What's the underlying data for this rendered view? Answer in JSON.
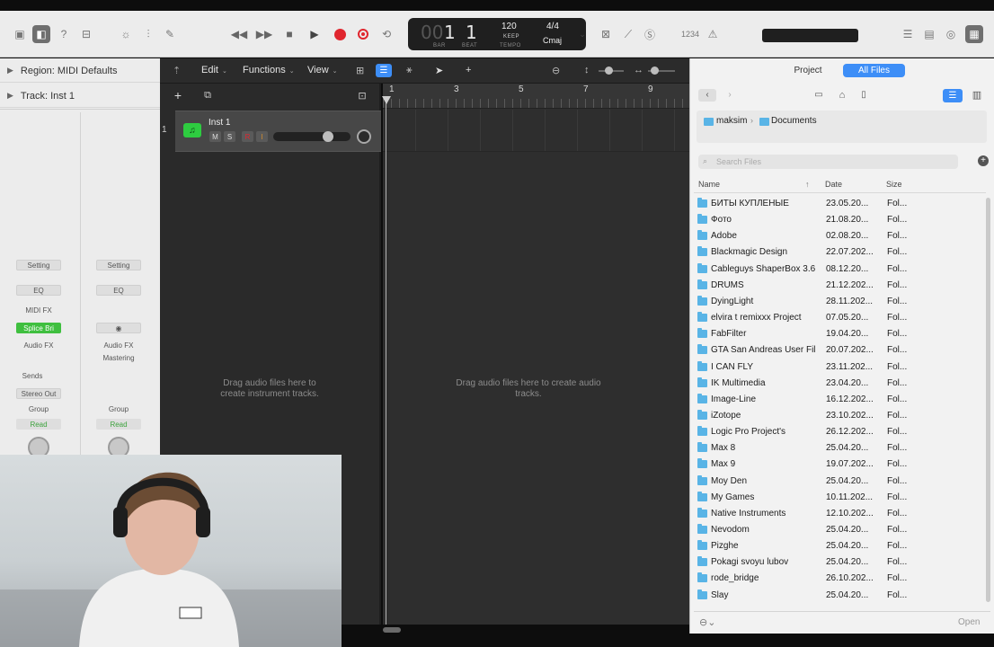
{
  "toolbar": {
    "lcd": {
      "bar_value": "1",
      "beat_value": "1",
      "bar_label": "BAR",
      "beat_label": "BEAT",
      "tempo_value": "120",
      "tempo_mode": "KEEP",
      "tempo_label": "TEMPO",
      "signature": "4/4",
      "key": "Cmaj"
    },
    "count_in": "1234"
  },
  "inspector": {
    "region_label": "Region: MIDI Defaults",
    "track_label": "Track: Inst 1",
    "strip1": {
      "setting": "Setting",
      "eq": "EQ",
      "midi_fx": "MIDI FX",
      "plugin": "Splice Bri",
      "audio_fx": "Audio FX",
      "sends": "Sends",
      "output": "Stereo Out",
      "group": "Group",
      "automation": "Read"
    },
    "strip2": {
      "setting": "Setting",
      "eq": "EQ",
      "audio_fx": "Audio FX",
      "mastering": "Mastering",
      "group": "Group",
      "automation": "Read"
    }
  },
  "tracks": {
    "menus": [
      "Edit",
      "Functions",
      "View"
    ],
    "track_number": "1",
    "track_name": "Inst 1",
    "mute": "M",
    "solo": "S",
    "record": "R",
    "input_monitor": "I",
    "header_hint": "Drag audio files here to create instrument tracks.",
    "arrange_hint": "Drag audio files here to create audio tracks.",
    "ruler": [
      "1",
      "3",
      "5",
      "7",
      "9"
    ]
  },
  "browser": {
    "tabs": [
      "Project",
      "All Files"
    ],
    "active_tab": "All Files",
    "path": [
      "maksim",
      "Documents"
    ],
    "search_placeholder": "Search Files",
    "columns": [
      "Name",
      "Date",
      "Size"
    ],
    "files": [
      {
        "name": "БИТЫ КУПЛЕНЫЕ",
        "date": "23.05.20...",
        "size": "Fol..."
      },
      {
        "name": "Фото",
        "date": "21.08.20...",
        "size": "Fol..."
      },
      {
        "name": "Adobe",
        "date": "02.08.20...",
        "size": "Fol..."
      },
      {
        "name": "Blackmagic Design",
        "date": "22.07.202...",
        "size": "Fol..."
      },
      {
        "name": "Cableguys ShaperBox 3.6",
        "date": "08.12.20...",
        "size": "Fol..."
      },
      {
        "name": "DRUMS",
        "date": "21.12.202...",
        "size": "Fol..."
      },
      {
        "name": "DyingLight",
        "date": "28.11.202...",
        "size": "Fol..."
      },
      {
        "name": "elvira t remixxx Project",
        "date": "07.05.20...",
        "size": "Fol..."
      },
      {
        "name": "FabFilter",
        "date": "19.04.20...",
        "size": "Fol..."
      },
      {
        "name": "GTA San Andreas User Fil",
        "date": "20.07.202...",
        "size": "Fol..."
      },
      {
        "name": "I CAN FLY",
        "date": "23.11.202...",
        "size": "Fol..."
      },
      {
        "name": "IK Multimedia",
        "date": "23.04.20...",
        "size": "Fol..."
      },
      {
        "name": "Image-Line",
        "date": "16.12.202...",
        "size": "Fol..."
      },
      {
        "name": "iZotope",
        "date": "23.10.202...",
        "size": "Fol..."
      },
      {
        "name": "Logic Pro Project's",
        "date": "26.12.202...",
        "size": "Fol..."
      },
      {
        "name": "Max 8",
        "date": "25.04.20...",
        "size": "Fol..."
      },
      {
        "name": "Max 9",
        "date": "19.07.202...",
        "size": "Fol..."
      },
      {
        "name": "Moy Den",
        "date": "25.04.20...",
        "size": "Fol..."
      },
      {
        "name": "My Games",
        "date": "10.11.202...",
        "size": "Fol..."
      },
      {
        "name": "Native Instruments",
        "date": "12.10.202...",
        "size": "Fol..."
      },
      {
        "name": "Nevodom",
        "date": "25.04.20...",
        "size": "Fol..."
      },
      {
        "name": "Pizghe",
        "date": "25.04.20...",
        "size": "Fol..."
      },
      {
        "name": "Pokagi svoyu lubov",
        "date": "25.04.20...",
        "size": "Fol..."
      },
      {
        "name": "rode_bridge",
        "date": "26.10.202...",
        "size": "Fol..."
      },
      {
        "name": "Slay",
        "date": "25.04.20...",
        "size": "Fol..."
      }
    ],
    "open_button": "Open"
  },
  "colors": {
    "record_red": "#e0262e",
    "selected_tab": "#3d8ef7",
    "folder_blue": "#59b4e6",
    "plugin_green": "#3fbf3f"
  }
}
